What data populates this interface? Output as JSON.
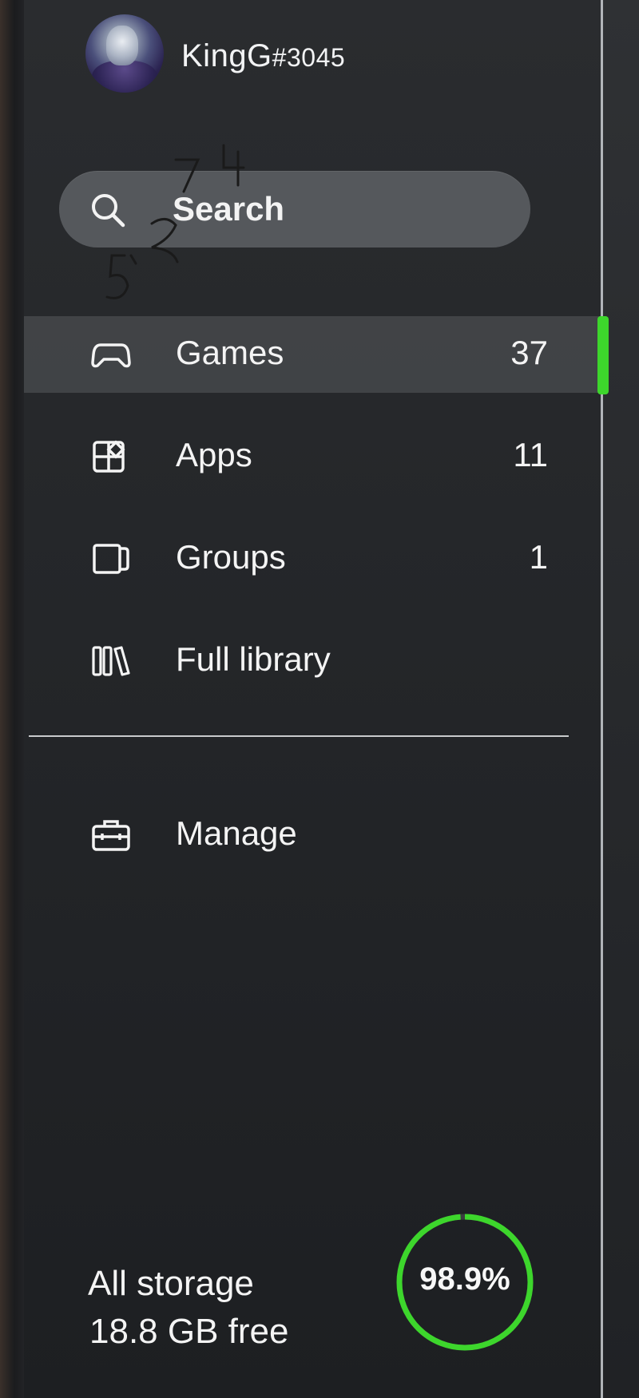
{
  "profile": {
    "gamertag": "KingG",
    "suffix": "#3045"
  },
  "search": {
    "label": "Search"
  },
  "nav": {
    "items": [
      {
        "label": "Games",
        "count": "37",
        "icon": "controller-icon",
        "selected": true
      },
      {
        "label": "Apps",
        "count": "11",
        "icon": "apps-grid-icon",
        "selected": false
      },
      {
        "label": "Groups",
        "count": "1",
        "icon": "groups-icon",
        "selected": false
      },
      {
        "label": "Full library",
        "count": "",
        "icon": "library-icon",
        "selected": false
      }
    ],
    "manage": {
      "label": "Manage",
      "icon": "toolbox-icon"
    }
  },
  "storage": {
    "label": "All storage",
    "free": "18.8 GB free",
    "used_percent_text": "98.9%",
    "used_fraction": 0.989
  },
  "colors": {
    "accent": "#3dd62c",
    "text": "#f4f4f4",
    "search_bg": "#55585c"
  }
}
